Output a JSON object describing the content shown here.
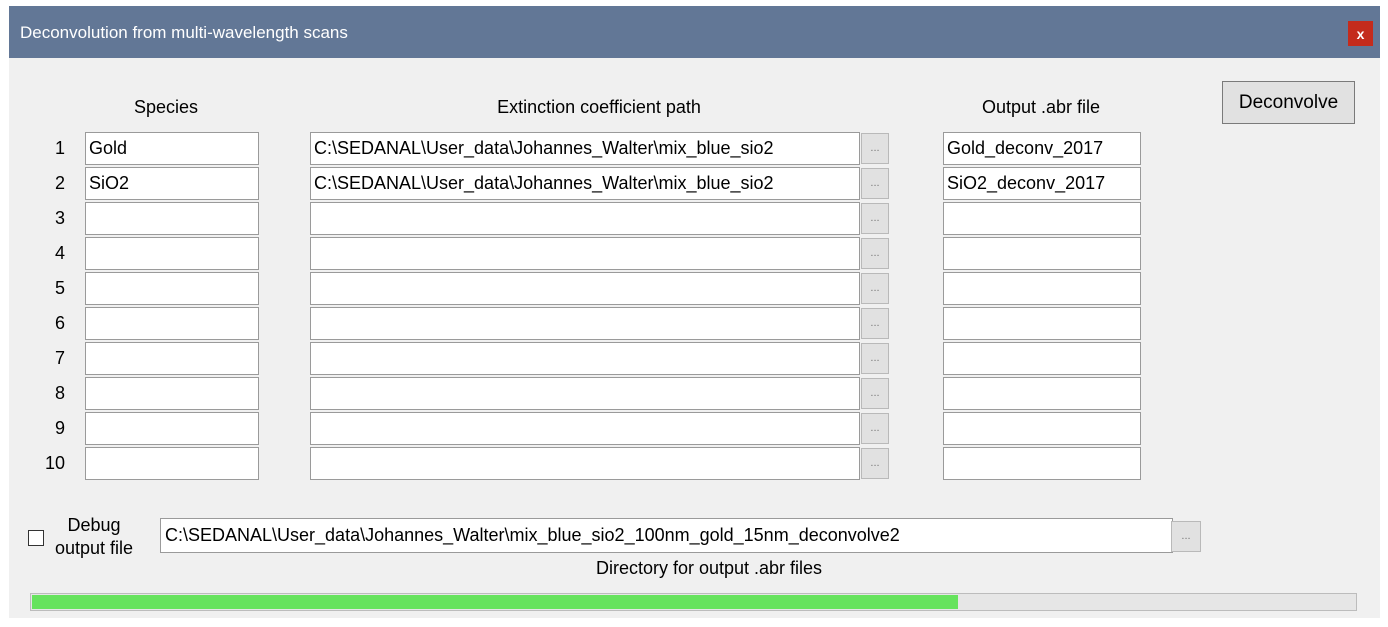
{
  "window": {
    "title": "Deconvolution from multi-wavelength scans",
    "close_label": "x"
  },
  "headers": {
    "species": "Species",
    "path": "Extinction coefficient path",
    "output": "Output .abr file"
  },
  "rows": [
    {
      "num": "1",
      "species": "Gold",
      "path": "C:\\SEDANAL\\User_data\\Johannes_Walter\\mix_blue_sio2",
      "output": "Gold_deconv_2017"
    },
    {
      "num": "2",
      "species": "SiO2",
      "path": "C:\\SEDANAL\\User_data\\Johannes_Walter\\mix_blue_sio2",
      "output": "SiO2_deconv_2017"
    },
    {
      "num": "3",
      "species": "",
      "path": "",
      "output": ""
    },
    {
      "num": "4",
      "species": "",
      "path": "",
      "output": ""
    },
    {
      "num": "5",
      "species": "",
      "path": "",
      "output": ""
    },
    {
      "num": "6",
      "species": "",
      "path": "",
      "output": ""
    },
    {
      "num": "7",
      "species": "",
      "path": "",
      "output": ""
    },
    {
      "num": "8",
      "species": "",
      "path": "",
      "output": ""
    },
    {
      "num": "9",
      "species": "",
      "path": "",
      "output": ""
    },
    {
      "num": "10",
      "species": "",
      "path": "",
      "output": ""
    }
  ],
  "browse_label": "...",
  "deconvolve_label": "Deconvolve",
  "debug": {
    "label_line1": "Debug",
    "label_line2": "output file",
    "checked": false
  },
  "output_dir": {
    "value": "C:\\SEDANAL\\User_data\\Johannes_Walter\\mix_blue_sio2_100nm_gold_15nm_deconvolve2",
    "caption": "Directory for output .abr files"
  },
  "progress": {
    "fraction": 0.7,
    "fill_color": "#66e35d"
  },
  "colors": {
    "titlebar": "#627796",
    "close": "#c42b1c"
  }
}
